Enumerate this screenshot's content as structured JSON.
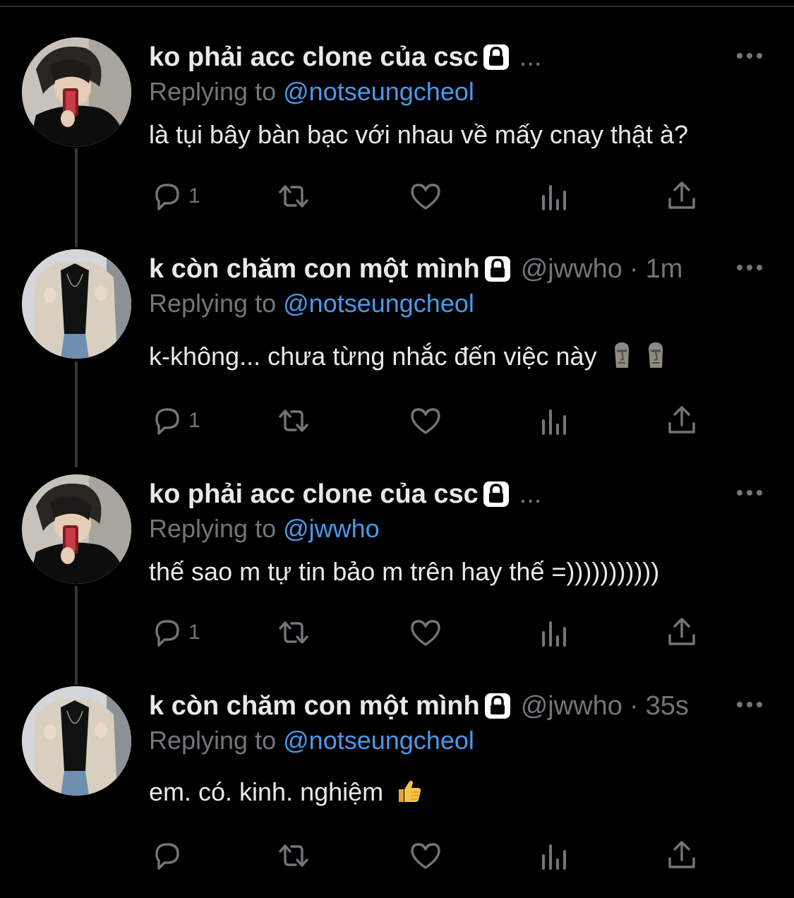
{
  "tweets": [
    {
      "name": "ko phải acc clone của csc",
      "handle": "",
      "time": "",
      "trail": "...",
      "reply_prefix": "Replying to",
      "reply_to": "@notseungcheol",
      "text": "là tụi bây bàn bạc với nhau về mấy cnay thật à?",
      "reply_count": "1",
      "avatar": "avatar-boy-mirror-selfie"
    },
    {
      "name": "k còn chăm con một mình",
      "handle": "@jwwho",
      "time": "1m",
      "trail": "",
      "reply_prefix": "Replying to",
      "reply_to": "@notseungcheol",
      "text": "k-không... chưa từng nhắc đến việc này",
      "reply_count": "1",
      "avatar": "avatar-beige-blazer"
    },
    {
      "name": "ko phải acc clone của csc",
      "handle": "",
      "time": "",
      "trail": "...",
      "reply_prefix": "Replying to",
      "reply_to": "@jwwho",
      "text": "thế sao m tự tin bảo m trên hay thế =)))))))))))",
      "reply_count": "1",
      "avatar": "avatar-boy-mirror-selfie"
    },
    {
      "name": "k còn chăm con một mình",
      "handle": "@jwwho",
      "time": "35s",
      "trail": "",
      "reply_prefix": "Replying to",
      "reply_to": "@notseungcheol",
      "text": "em. có. kinh. nghiệm",
      "reply_count": "",
      "avatar": "avatar-beige-blazer"
    }
  ],
  "icons": {
    "reply": "comment-icon",
    "retweet": "retweet-icon",
    "like": "heart-icon",
    "analytics": "analytics-icon",
    "share": "share-icon",
    "more": "more-icon",
    "lock": "lock-icon",
    "moai_emoji": "moai-emoji-icon",
    "thumbs_up_emoji": "thumbs-up-emoji-icon"
  },
  "colors": {
    "background": "#000000",
    "text": "#e7e9ea",
    "muted": "#71767b",
    "mention": "#4a99e9",
    "thread_line": "#333639"
  }
}
